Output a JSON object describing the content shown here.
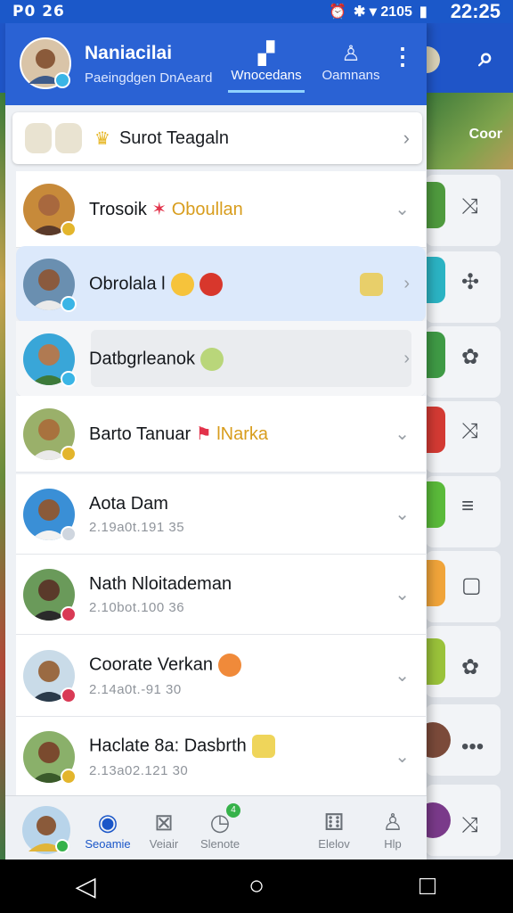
{
  "status_bar": {
    "left_text": "P0 26",
    "indicators": "✱ ▾ 2105",
    "time": "22:25"
  },
  "background_app": {
    "banner_label": "Coor"
  },
  "drawer": {
    "header": {
      "name": "Naniacilai",
      "subtitle": "Paeingdgen DnAeard",
      "tabs": [
        {
          "label": "Wnocedans",
          "icon": "pin-icon",
          "active": true
        },
        {
          "label": "Oamnans",
          "icon": "contacts-icon",
          "active": false
        }
      ]
    },
    "promo": {
      "title": "Surot Teagaln"
    },
    "contacts": [
      {
        "name": "Trosoik",
        "name_suffix": "Oboullan",
        "meta": "",
        "style": "normal",
        "badge": "#e3b52c"
      },
      {
        "name": "Obrolala l",
        "name_suffix": "",
        "meta": "",
        "style": "highlight",
        "badge": "#3ab5e6"
      },
      {
        "name": "Datbgrleanok",
        "name_suffix": "",
        "meta": "",
        "style": "group2",
        "badge": "#3ab5e6"
      },
      {
        "name": "Barto Tanuar",
        "name_suffix": "lNarka",
        "meta": "",
        "style": "normal",
        "badge": "#e3b52c"
      },
      {
        "name": "Aota Dam",
        "name_suffix": "",
        "meta": "2.19a0t.191 35",
        "style": "normal",
        "badge": "#cfd6df"
      },
      {
        "name": "Nath Nloitademan",
        "name_suffix": "",
        "meta": "2.10bot.100 36",
        "style": "normal",
        "badge": "#d93a55"
      },
      {
        "name": "Coorate Verkan",
        "name_suffix": "",
        "meta": "2.14a0t.-91 30",
        "style": "normal",
        "badge": "#d93a55"
      },
      {
        "name": "Haclate 8a: Dasbrth",
        "name_suffix": "",
        "meta": "2.13a02.121 30",
        "style": "normal",
        "badge": "#e3b52c"
      }
    ],
    "bottom_nav": [
      {
        "label": "Seoamie",
        "icon": "camera-icon",
        "active": true
      },
      {
        "label": "Veiair",
        "icon": "box-icon",
        "active": false
      },
      {
        "label": "Slenote",
        "icon": "clock-icon",
        "active": false,
        "badge": "4"
      },
      {
        "label": "Elelov",
        "icon": "dice-icon",
        "active": false
      },
      {
        "label": "Hlp",
        "icon": "person-icon",
        "active": false
      }
    ]
  },
  "colors": {
    "primary": "#2a62d4",
    "accent": "#1a56c8",
    "highlight": "#dce9fb"
  }
}
